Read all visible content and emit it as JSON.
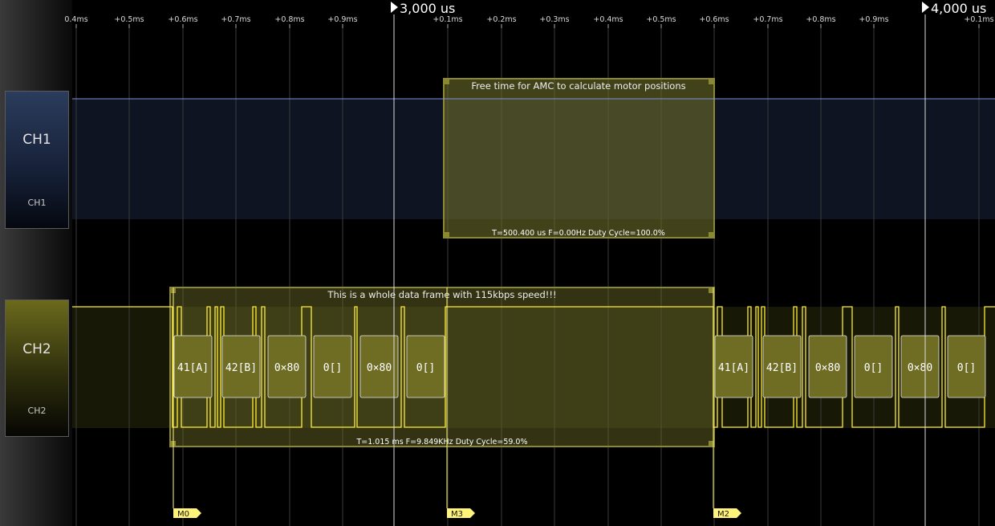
{
  "colors": {
    "ch1": "#7e8fd8",
    "ch2": "#ffee33",
    "annotation": "#6b6a2a",
    "marker": "#fff37a"
  },
  "ticks": [
    "0.4ms",
    "+0.5ms",
    "+0.6ms",
    "+0.7ms",
    "+0.8ms",
    "+0.9ms",
    "+0.1ms",
    "+0.2ms",
    "+0.3ms",
    "+0.4ms",
    "+0.5ms",
    "+0.6ms",
    "+0.7ms",
    "+0.8ms",
    "+0.9ms",
    "+0.1ms"
  ],
  "time_markers": [
    "3,000 us",
    "4,000 us"
  ],
  "channels": [
    {
      "name": "CH1",
      "label": "CH1"
    },
    {
      "name": "CH2",
      "label": "CH2"
    }
  ],
  "annotations": {
    "free_time": {
      "text": "Free time for AMC to calculate motor positions",
      "measurement": "T=500.400 us    F=0.00Hz    Duty Cycle=100.0%"
    },
    "data_frame": {
      "text": "This is a whole data frame with 115kbps speed!!!",
      "measurement": "T=1.015 ms    F=9.849KHz    Duty Cycle=59.0%"
    }
  },
  "decoded_bytes": {
    "frame1": [
      "41[A]",
      "42[B]",
      "0×80",
      "0[]",
      "0×80",
      "0[]"
    ],
    "frame2": [
      "41[A]",
      "42[B]",
      "0×80",
      "0[]",
      "0×80",
      "0[]"
    ]
  },
  "markers": [
    "M0",
    "M3",
    "M2"
  ]
}
